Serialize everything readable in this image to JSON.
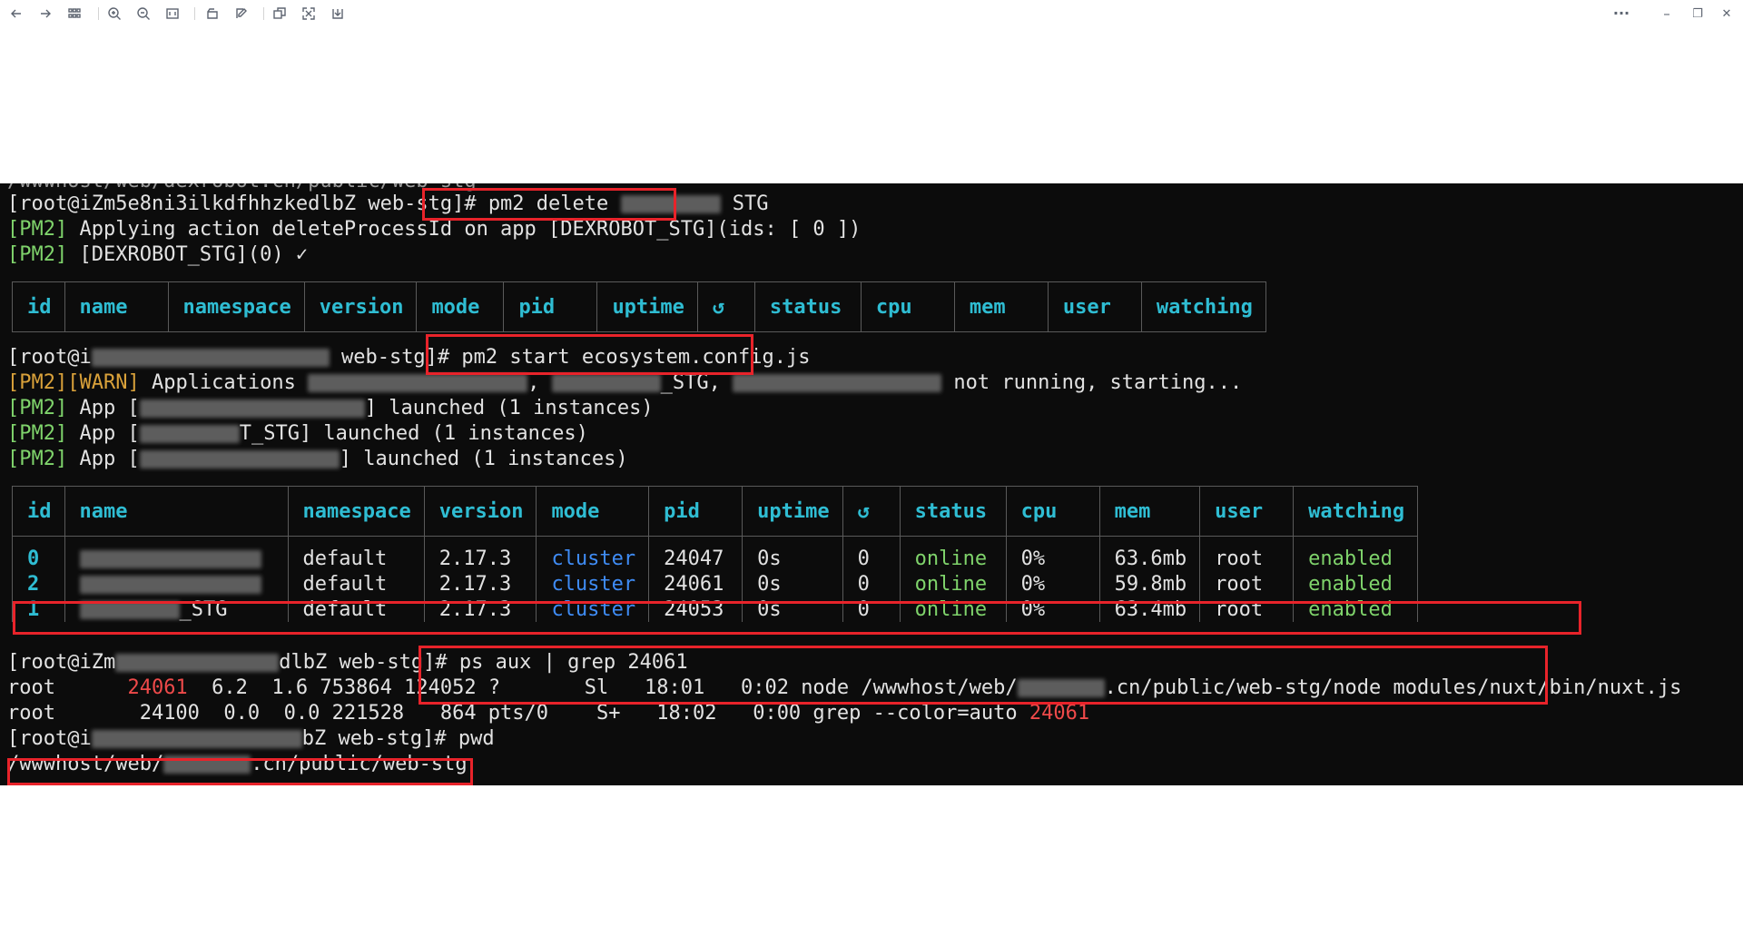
{
  "toolbar": {
    "left": [
      {
        "name": "back-icon",
        "glyph": "←"
      },
      {
        "name": "forward-icon",
        "glyph": "→"
      },
      {
        "name": "grid-icon",
        "glyph": "⊞"
      },
      {
        "name": "zoom-in-icon",
        "glyph": "⊕"
      },
      {
        "name": "zoom-out-icon",
        "glyph": "⊖"
      },
      {
        "name": "fit-window-icon",
        "glyph": "▭"
      },
      {
        "name": "rotate-icon",
        "glyph": "↺"
      },
      {
        "name": "edit-icon",
        "glyph": "✎"
      },
      {
        "name": "copy-icon",
        "glyph": "⧉"
      },
      {
        "name": "fullscreen-icon",
        "glyph": "⤢"
      },
      {
        "name": "save-icon",
        "glyph": "⤓"
      }
    ],
    "right": [
      {
        "name": "more-icon",
        "glyph": "···"
      },
      {
        "name": "minimize-icon",
        "glyph": "–"
      },
      {
        "name": "restore-icon",
        "glyph": "❐"
      },
      {
        "name": "close-icon",
        "glyph": "✕"
      }
    ]
  },
  "terminal": {
    "lines": {
      "cut_top": "/wwwhost/web/dexrobot.cn/public/web-stg",
      "prompt1": "[root@iZm5e8ni3ilkdfhhzkedlbZ web-stg]# ",
      "cmd1a": "pm2 delete ",
      "cmd1b": " STG",
      "pm2a_tag": "[PM2]",
      "pm2a_text": " Applying action deleteProcessId on app [DEXROBOT_STG](ids: [ 0 ])",
      "pm2b_tag": "[PM2]",
      "pm2b_text": " [DEXROBOT_STG](0) ✓",
      "prompt2a": "[root@i",
      "prompt2b": " web-stg]# ",
      "cmd2": "pm2 start ecosystem.config.js",
      "warn_tag": "[PM2][WARN]",
      "warn_text1": " Applications ",
      "warn_text2": ", ",
      "warn_text3": "_STG, ",
      "warn_text4": " not running, starting...",
      "app1_tag": "[PM2]",
      "app1_a": " App [",
      "app1_b": "] launched (1 instances)",
      "app2_tag": "[PM2]",
      "app2_a": " App [",
      "app2_b": "T_STG] launched (1 instances)",
      "app3_tag": "[PM2]",
      "app3_a": " App [",
      "app3_b": "] launched (1 instances)",
      "prompt3a": "[root@iZm",
      "prompt3b": "dlbZ web-stg]# ",
      "cmd3": "ps aux | grep 24061",
      "ps1_user": "root      ",
      "ps1_pid": "24061",
      "ps1_rest": "  6.2  1.6 753864 124052 ?       Sl   18:01   0:02 node /wwwhost/web/",
      "ps1_tail": ".cn/public/web-stg/node modules/nuxt/bin/nuxt.js",
      "ps2_user": "root      ",
      "ps2_rest": " 24100  0.0  0.0 221528   864 pts/0    S+   18:02   0:00 grep --color=auto ",
      "ps2_pid": "24061",
      "prompt4a": "[root@i",
      "prompt4b": "bZ web-stg]# ",
      "cmd4": "pwd",
      "pwd_a": "/wwwhost/web/",
      "pwd_b": ".cn/public/web-stg"
    },
    "table_headers": [
      "id",
      "name",
      "namespace",
      "version",
      "mode",
      "pid",
      "uptime",
      "↺",
      "status",
      "cpu",
      "mem",
      "user",
      "watching"
    ],
    "process_rows": [
      {
        "id": "0",
        "name": "",
        "namespace": "default",
        "version": "2.17.3",
        "mode": "cluster",
        "pid": "24047",
        "uptime": "0s",
        "restarts": "0",
        "status": "online",
        "cpu": "0%",
        "mem": "63.6mb",
        "user": "root",
        "watching": "enabled"
      },
      {
        "id": "2",
        "name": "",
        "namespace": "default",
        "version": "2.17.3",
        "mode": "cluster",
        "pid": "24061",
        "uptime": "0s",
        "restarts": "0",
        "status": "online",
        "cpu": "0%",
        "mem": "59.8mb",
        "user": "root",
        "watching": "enabled"
      },
      {
        "id": "1",
        "name": "_STG",
        "namespace": "default",
        "version": "2.17.3",
        "mode": "cluster",
        "pid": "24053",
        "uptime": "0s",
        "restarts": "0",
        "status": "online",
        "cpu": "0%",
        "mem": "63.4mb",
        "user": "root",
        "watching": "enabled"
      }
    ]
  },
  "colors": {
    "pm2_tag": "#7fd36b",
    "warn_tag": "#d9a13a",
    "highlight": "#ef4a4a",
    "annotation": "#e8232a",
    "table_header": "#2fbdd3",
    "mode": "#3f8cf5"
  }
}
